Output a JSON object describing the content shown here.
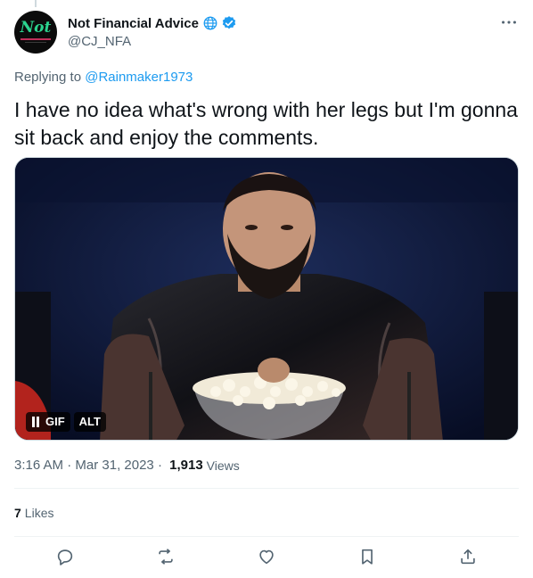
{
  "author": {
    "display_name": "Not Financial Advice",
    "handle": "@CJ_NFA",
    "avatar_text": "Not"
  },
  "reply": {
    "prefix": "Replying to",
    "to": "@Rainmaker1973"
  },
  "tweet": {
    "text": "I have no idea what's wrong with her legs but I'm gonna sit back and enjoy the comments."
  },
  "media": {
    "gif_label": "GIF",
    "alt_label": "ALT"
  },
  "meta": {
    "time": "3:16 AM",
    "separator": " · ",
    "date": "Mar 31, 2023",
    "separator2": " · ",
    "views_count": "1,913",
    "views_label": "Views"
  },
  "stats": {
    "likes_count": "7",
    "likes_label": "Likes"
  },
  "icons": {
    "globe": "globe-icon",
    "verified": "verified-badge-icon",
    "more": "more-icon",
    "reply": "reply-icon",
    "retweet": "retweet-icon",
    "like": "like-icon",
    "bookmark": "bookmark-icon",
    "share": "share-icon",
    "pause": "pause-icon"
  },
  "colors": {
    "accent": "#1d9bf0",
    "text": "#0f1419",
    "secondary": "#536471"
  }
}
